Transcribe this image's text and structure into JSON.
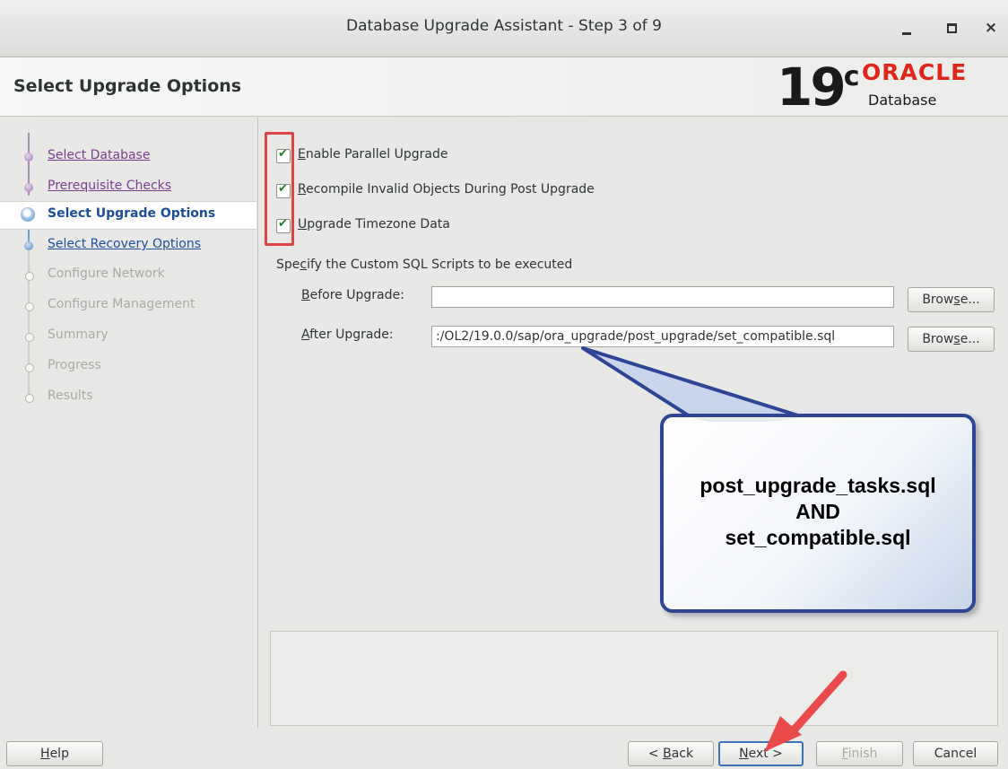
{
  "window": {
    "title": "Database Upgrade Assistant - Step 3 of 9",
    "controls": {
      "minimize_icon": "minimize-icon",
      "maximize_icon": "maximize-icon",
      "close_glyph": "×"
    }
  },
  "header": {
    "heading": "Select Upgrade Options",
    "logo": {
      "version": "19",
      "version_suffix": "c",
      "brand": "ORACLE",
      "product": "Database",
      "brand_color": "#e0261b"
    }
  },
  "steps": [
    {
      "label": "Select Database",
      "state": "done"
    },
    {
      "label": "Prerequisite Checks",
      "state": "done"
    },
    {
      "label": "Select Upgrade Options",
      "state": "active"
    },
    {
      "label": "Select Recovery Options",
      "state": "link"
    },
    {
      "label": "Configure Network",
      "state": "pending"
    },
    {
      "label": "Configure Management",
      "state": "pending"
    },
    {
      "label": "Summary",
      "state": "pending"
    },
    {
      "label": "Progress",
      "state": "pending"
    },
    {
      "label": "Results",
      "state": "pending"
    }
  ],
  "options": {
    "parallel": {
      "mnemonic": "E",
      "rest": "nable Parallel Upgrade",
      "checked": true
    },
    "recompile": {
      "mnemonic": "R",
      "rest": "ecompile Invalid Objects During Post Upgrade",
      "checked": true
    },
    "timezone": {
      "mnemonic": "U",
      "rest": "pgrade Timezone Data",
      "checked": true
    }
  },
  "scripts": {
    "section_pre": "Spe",
    "section_mnemonic": "c",
    "section_post": "ify the Custom SQL Scripts to be executed",
    "before": {
      "mnemonic": "B",
      "rest": "efore Upgrade:",
      "value": ""
    },
    "after": {
      "mnemonic": "A",
      "rest": "fter Upgrade:",
      "value": ":/OL2/19.0.0/sap/ora_upgrade/post_upgrade/set_compatible.sql"
    },
    "browse": {
      "pre": "Brow",
      "mnemonic": "s",
      "post": "e..."
    }
  },
  "callout": {
    "line1": "post_upgrade_tasks.sql",
    "line2": "AND",
    "line3": "set_compatible.sql"
  },
  "footer": {
    "help": {
      "mnemonic": "H",
      "rest": "elp"
    },
    "back": {
      "pre": "< ",
      "mnemonic": "B",
      "rest": "ack"
    },
    "next": {
      "mnemonic": "N",
      "rest": "ext >"
    },
    "finish": {
      "mnemonic": "F",
      "rest": "inish"
    },
    "cancel": "Cancel"
  },
  "colors": {
    "annotation_red": "#e04545",
    "callout_border": "#2e4596",
    "arrow": "#ea4a4a"
  }
}
